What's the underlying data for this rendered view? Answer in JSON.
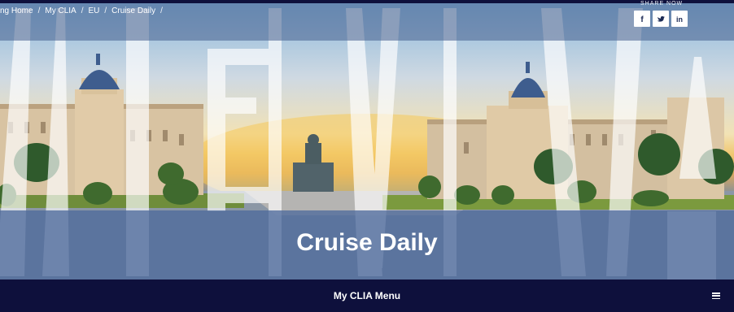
{
  "breadcrumb": {
    "items": [
      "ng Home",
      "My CLIA",
      "EU",
      "Cruise Daily"
    ],
    "separator": "/"
  },
  "share": {
    "label": "SHARE NOW",
    "icons": [
      "facebook-icon",
      "twitter-icon",
      "linkedin-icon"
    ],
    "glyphs": {
      "facebook": "f",
      "twitter": "t",
      "linkedin": "in"
    }
  },
  "hero": {
    "title": "Cruise Daily"
  },
  "menu": {
    "label": "My CLIA Menu",
    "toggle_icon": "hamburger-icon"
  },
  "colors": {
    "nav_background": "#0e103c",
    "title_band": "#4e6a9c",
    "text": "#ffffff"
  }
}
